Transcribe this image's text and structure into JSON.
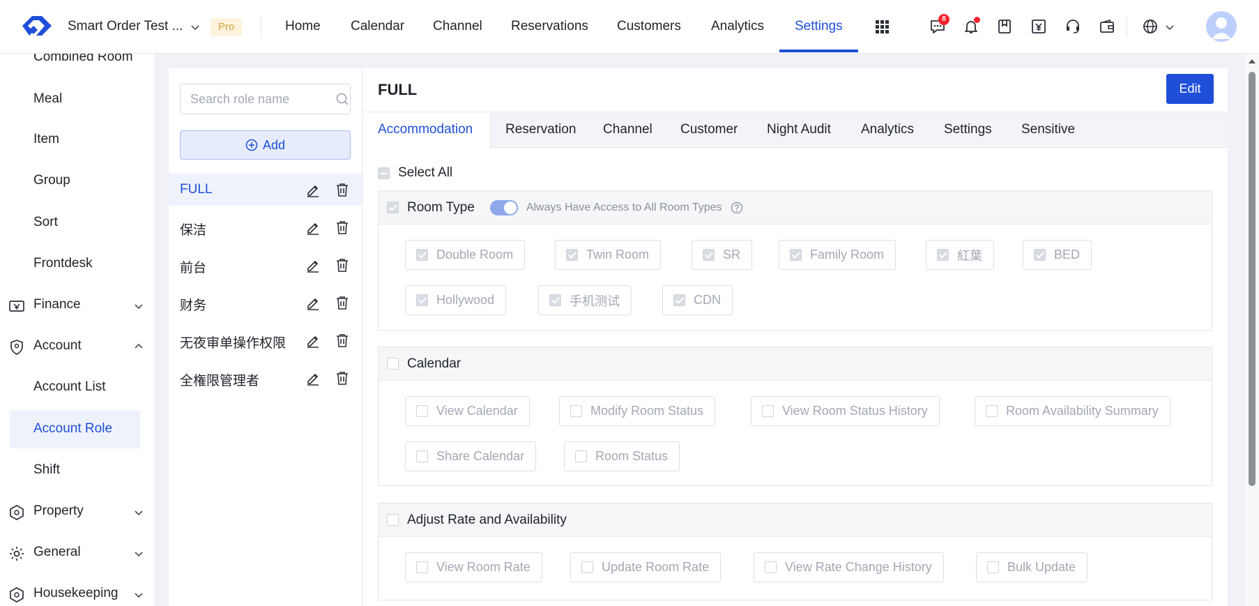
{
  "header": {
    "hotel_name": "Smart Order Test ...",
    "pro_badge": "Pro",
    "nav": [
      "Home",
      "Calendar",
      "Channel",
      "Reservations",
      "Customers",
      "Analytics",
      "Settings"
    ],
    "active_nav": "Settings",
    "message_count": "8",
    "accent_color": "#1f4ed8"
  },
  "sidebar": {
    "items": {
      "combined_room": "Combined Room",
      "meal": "Meal",
      "item": "Item",
      "group": "Group",
      "sort": "Sort",
      "frontdesk": "Frontdesk",
      "finance": "Finance",
      "account": "Account",
      "account_list": "Account List",
      "account_role": "Account Role",
      "shift": "Shift",
      "property": "Property",
      "general": "General",
      "housekeeping": "Housekeeping"
    },
    "active_item": "Account Role"
  },
  "roles": {
    "search_placeholder": "Search role name",
    "add_label": "Add",
    "list": [
      "FULL",
      "保洁",
      "前台",
      "财务",
      "无夜审单操作权限",
      "全権限管理者"
    ],
    "active": "FULL"
  },
  "main": {
    "title": "FULL",
    "edit_label": "Edit",
    "tabs": [
      "Accommodation",
      "Reservation",
      "Channel",
      "Customer",
      "Night Audit",
      "Analytics",
      "Settings",
      "Sensitive"
    ],
    "active_tab": "Accommodation",
    "select_all": "Select All",
    "room_type": {
      "title": "Room Type",
      "toggle_label": "Always Have Access to All Room Types",
      "toggle_on": true,
      "options": [
        "Double Room",
        "Twin Room",
        "SR",
        "Family Room",
        "紅葉",
        "BED",
        "Hollywood",
        "手机测试",
        "CDN"
      ]
    },
    "calendar": {
      "title": "Calendar",
      "options": [
        "View Calendar",
        "Modify Room Status",
        "View Room Status History",
        "Room Availability Summary",
        "Share Calendar",
        "Room Status"
      ]
    },
    "adjust_rate": {
      "title": "Adjust Rate and Availability",
      "options": [
        "View Room Rate",
        "Update Room Rate",
        "View Rate Change History",
        "Bulk Update"
      ]
    }
  }
}
